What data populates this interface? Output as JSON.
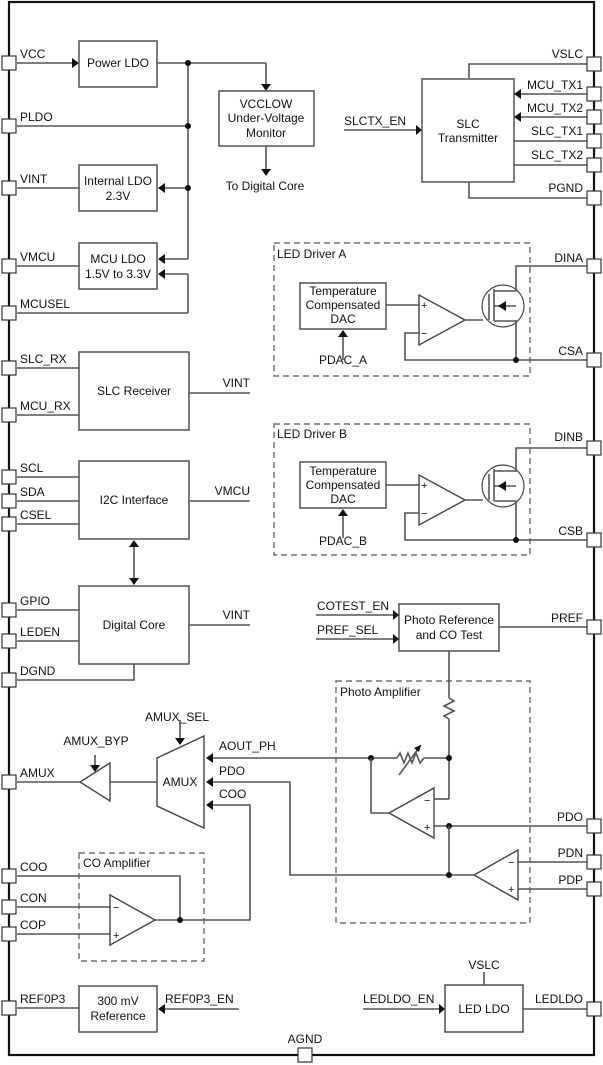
{
  "left_pins": {
    "vcc": "VCC",
    "pldo": "PLDO",
    "vint": "VINT",
    "vmcu": "VMCU",
    "mcusel": "MCUSEL",
    "slc_rx": "SLC_RX",
    "mcu_rx": "MCU_RX",
    "scl": "SCL",
    "sda": "SDA",
    "csel": "CSEL",
    "gpio": "GPIO",
    "leden": "LEDEN",
    "dgnd": "DGND",
    "amux": "AMUX",
    "coo": "COO",
    "con": "CON",
    "cop": "COP",
    "ref0p3": "REF0P3"
  },
  "right_pins": {
    "vslc": "VSLC",
    "mcu_tx1": "MCU_TX1",
    "mcu_tx2": "MCU_TX2",
    "slc_tx1": "SLC_TX1",
    "slc_tx2": "SLC_TX2",
    "pgnd": "PGND",
    "dina": "DINA",
    "csa": "CSA",
    "dinb": "DINB",
    "csb": "CSB",
    "pref": "PREF",
    "pdo": "PDO",
    "pdn": "PDN",
    "pdp": "PDP",
    "ledldo": "LEDLDO"
  },
  "bottom_pins": {
    "agnd": "AGND"
  },
  "blocks": {
    "power_ldo": "Power LDO",
    "vcclow": [
      "VCCLOW",
      "Under-Voltage",
      "Monitor"
    ],
    "internal_ldo": [
      "Internal LDO",
      "2.3V"
    ],
    "mcu_ldo": [
      "MCU LDO",
      "1.5V to 3.3V"
    ],
    "slc_transmitter": [
      "SLC",
      "Transmitter"
    ],
    "slc_receiver": "SLC Receiver",
    "i2c_interface": "I2C Interface",
    "digital_core": "Digital Core",
    "dac": [
      "Temperature",
      "Compensated",
      "DAC"
    ],
    "photo_ref": [
      "Photo Reference",
      "and CO Test"
    ],
    "amux": "AMUX",
    "reference_300mv": [
      "300 mV",
      "Reference"
    ],
    "led_ldo": "LED LDO"
  },
  "groups": {
    "led_driver_a": "LED Driver A",
    "led_driver_b": "LED Driver B",
    "photo_amplifier": "Photo Amplifier",
    "co_amplifier": "CO Amplifier"
  },
  "signals": {
    "to_digital_core": "To Digital Core",
    "slctx_en": "SLCTX_EN",
    "pdac_a": "PDAC_A",
    "pdac_b": "PDAC_B",
    "receiver_supply": "VINT",
    "i2c_supply": "VMCU",
    "core_supply": "VINT",
    "cotest_en": "COTEST_EN",
    "pref_sel": "PREF_SEL",
    "amux_sel": "AMUX_SEL",
    "amux_byp": "AMUX_BYP",
    "aout_ph": "AOUT_PH",
    "pdo": "PDO",
    "coo": "COO",
    "ref0p3_en": "REF0P3_EN",
    "ledldo_en": "LEDLDO_EN",
    "ledldo_supply": "VSLC"
  }
}
